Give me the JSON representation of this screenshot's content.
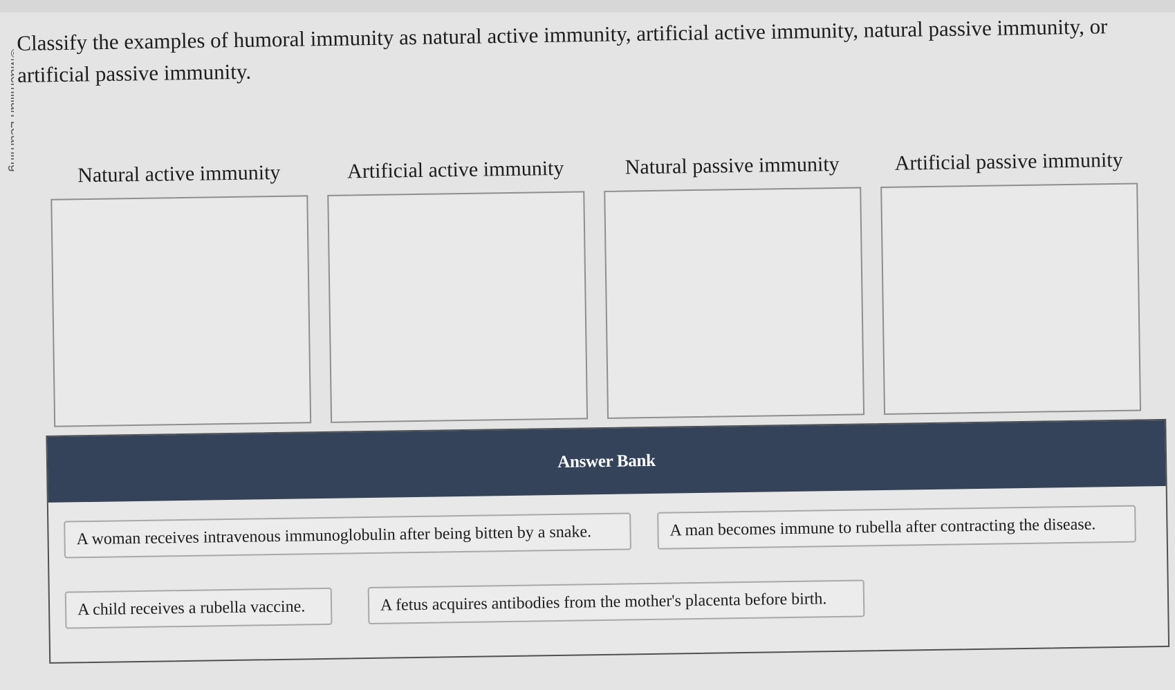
{
  "copyright": "©Macmillan Learning",
  "question": {
    "prompt": "Classify the examples of humoral immunity as natural active immunity, artificial active immunity, natural passive immunity, or artificial passive immunity."
  },
  "bins": [
    {
      "label": "Natural active immunity"
    },
    {
      "label": "Artificial active immunity"
    },
    {
      "label": "Natural passive immunity"
    },
    {
      "label": "Artificial passive immunity"
    }
  ],
  "answer_bank": {
    "title": "Answer Bank",
    "items": [
      {
        "text": "A woman receives intravenous immunoglobulin after being bitten by a snake."
      },
      {
        "text": "A man becomes immune to rubella after contracting the disease."
      },
      {
        "text": "A child receives a rubella vaccine."
      },
      {
        "text": "A fetus acquires antibodies from the mother's placenta before birth."
      }
    ]
  }
}
